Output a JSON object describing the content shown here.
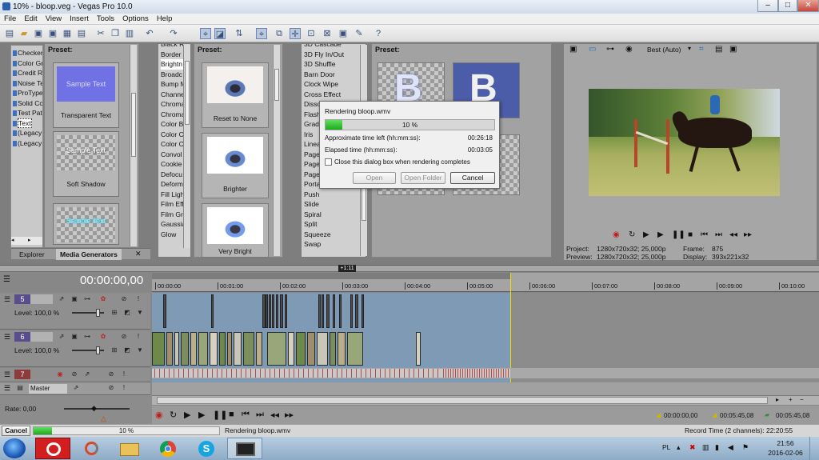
{
  "window": {
    "title": "10% - bloop.veg - Vegas Pro 10.0",
    "min": "–",
    "max": "□",
    "close": "✕"
  },
  "menu": [
    "File",
    "Edit",
    "View",
    "Insert",
    "Tools",
    "Options",
    "Help"
  ],
  "explorer": {
    "items": [
      "Checkerb",
      "Color Gr",
      "Credit Ro",
      "Noise Te",
      "ProType",
      "Solid Col",
      "Test Pat",
      "Text",
      "(Legacy",
      "(Legacy"
    ],
    "selected": "Text",
    "tabs": [
      "Explorer",
      "Media Generators"
    ]
  },
  "generators": {
    "header": "Preset:",
    "presets": [
      {
        "label": "Transparent Text",
        "sample": "Sample Text"
      },
      {
        "label": "Soft Shadow",
        "sample": "Sample Text"
      },
      {
        "label": "",
        "sample": "Sample Text"
      }
    ]
  },
  "fx": {
    "items": [
      "Black R",
      "Border",
      "Brightn",
      "Broadc",
      "Bump M",
      "Channe",
      "Chroma",
      "Chroma",
      "Color B",
      "Color C",
      "Color C",
      "Convol",
      "Cookie",
      "Defocu",
      "Deform",
      "Fill Ligh",
      "Film Eff",
      "Film Gra",
      "Gaussia",
      "Glow"
    ],
    "header": "Preset:",
    "presets": [
      "Reset to None",
      "Brighter",
      "Very Bright"
    ]
  },
  "transitions": {
    "items": [
      "3D Cascade",
      "3D Fly In/Out",
      "3D Shuffle",
      "Barn Door",
      "Clock Wipe",
      "Cross Effect",
      "Dissolve",
      "Flash",
      "Gradient",
      "Iris",
      "Linear",
      "Page",
      "Page",
      "Page",
      "Portals",
      "Push",
      "Slide",
      "Spiral",
      "Split",
      "Squeeze",
      "Swap"
    ],
    "header": "Preset:"
  },
  "preview": {
    "quality": "Best (Auto)",
    "project_label": "Project:",
    "project": "1280x720x32; 25,000p",
    "preview_label": "Preview:",
    "preview": "1280x720x32; 25,000p",
    "frame_label": "Frame:",
    "frame": "875",
    "display_label": "Display:",
    "display": "393x221x32"
  },
  "dialog": {
    "title": "Rendering bloop.wmv",
    "progress": 0.1,
    "progress_text": "10 %",
    "time_left_label": "Approximate time left (hh:mm:ss):",
    "time_left": "00:26:18",
    "elapsed_label": "Elapsed time (hh:mm:ss):",
    "elapsed": "00:03:05",
    "close_checkbox": "Close this dialog box when rendering completes",
    "open": "Open",
    "open_folder": "Open Folder",
    "cancel": "Cancel"
  },
  "timeline": {
    "timecode": "00:00:00,00",
    "marker": "+1:11",
    "ruler": [
      "00:00:00",
      "00:01:00",
      "00:02:00",
      "00:03:00",
      "00:04:00",
      "00:05:00",
      "00:06:00",
      "00:07:00",
      "00:08:00",
      "00:09:00",
      "00:10:00"
    ],
    "tracks": [
      {
        "num": "5",
        "level": "Level: 100,0 %"
      },
      {
        "num": "6",
        "level": "Level: 100,0 %"
      },
      {
        "num": "7"
      }
    ],
    "master": "Master",
    "rate": "Rate: 0,00",
    "t1": "00:00:00,00",
    "t2": "00:05:45,08",
    "t3": "00:05:45,08"
  },
  "status": {
    "cancel": "Cancel",
    "progress": 0.1,
    "progress_text": "10 %",
    "rendering": "Rendering bloop.wmv",
    "record_time": "Record Time (2 channels): 22:20:55"
  },
  "taskbar": {
    "lang": "PL",
    "time": "21:56",
    "date": "2016-02-06"
  }
}
